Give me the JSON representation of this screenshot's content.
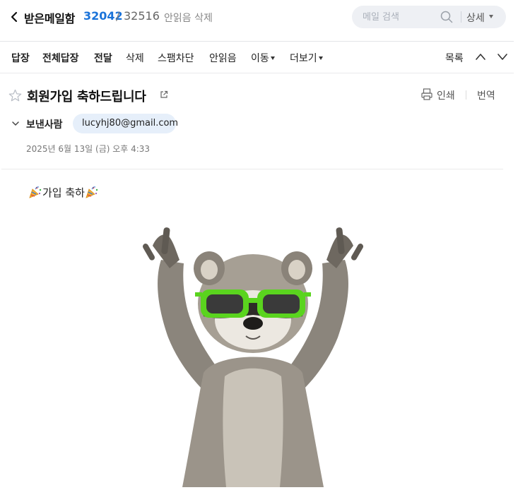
{
  "header": {
    "mailbox_name": "받은메일함",
    "unread_count": "32042",
    "separator": "/",
    "total_count": "32516",
    "delete_unread_label": "안읽음 삭제",
    "search_placeholder": "메일 검색",
    "detail_label": "상세"
  },
  "toolbar": {
    "reply": "답장",
    "reply_all": "전체답장",
    "forward": "전달",
    "delete": "삭제",
    "block_spam": "스팸차단",
    "mark_unread": "안읽음",
    "move": "이동",
    "more": "더보기",
    "list": "목록"
  },
  "message": {
    "subject": "회원가입 축하드립니다",
    "print_label": "인쇄",
    "translate_label": "번역",
    "sender_label": "보낸사람",
    "sender_email": "lucyhj80@gmail.com",
    "date": "2025년 6월 13일 (금) 오후 4:33",
    "body_text": "가입 축하"
  },
  "colors": {
    "accent_blue": "#1a73d9",
    "chip_bg": "#e6effa",
    "search_bg": "#eef0f4",
    "sunglasses_green": "#5ad41e"
  },
  "icons": [
    "chevron-left-icon",
    "search-icon",
    "caret-down-icon",
    "chevron-up-icon",
    "chevron-down-icon",
    "star-icon",
    "popout-icon",
    "printer-icon",
    "party-popper-icon"
  ]
}
